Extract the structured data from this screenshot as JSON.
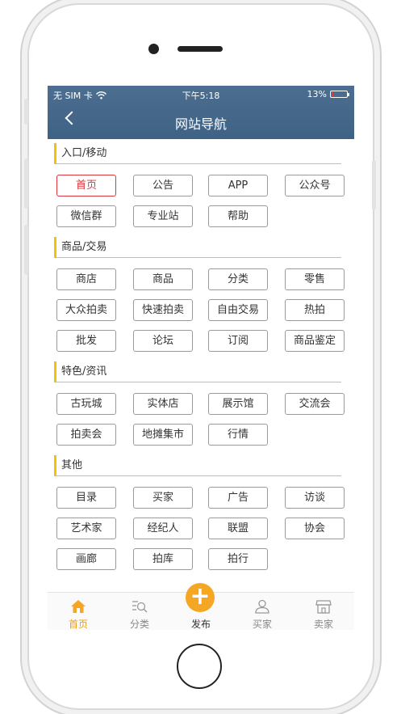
{
  "status_bar": {
    "carrier": "无 SIM 卡",
    "time": "下午5:18",
    "battery": "13%",
    "battery_level": 0.13
  },
  "header": {
    "title": "网站导航"
  },
  "sections": [
    {
      "title": "入口/移动",
      "items": [
        "首页",
        "公告",
        "APP",
        "公众号",
        "微信群",
        "专业站",
        "帮助"
      ]
    },
    {
      "title": "商品/交易",
      "items": [
        "商店",
        "商品",
        "分类",
        "零售",
        "大众拍卖",
        "快速拍卖",
        "自由交易",
        "热拍",
        "批发",
        "论坛",
        "订阅",
        "商品鉴定"
      ]
    },
    {
      "title": "特色/资讯",
      "items": [
        "古玩城",
        "实体店",
        "展示馆",
        "交流会",
        "拍卖会",
        "地摊集市",
        "行情"
      ]
    },
    {
      "title": "其他",
      "items": [
        "目录",
        "买家",
        "广告",
        "访谈",
        "艺术家",
        "经纪人",
        "联盟",
        "协会",
        "画廊",
        "拍库",
        "拍行"
      ]
    }
  ],
  "tabs": [
    "首页",
    "分类",
    "发布",
    "买家",
    "卖家"
  ],
  "colors": {
    "header": "#456889",
    "accent": "#f5a623",
    "active_red": "#d9363e",
    "section_marker": "#f2c400"
  }
}
